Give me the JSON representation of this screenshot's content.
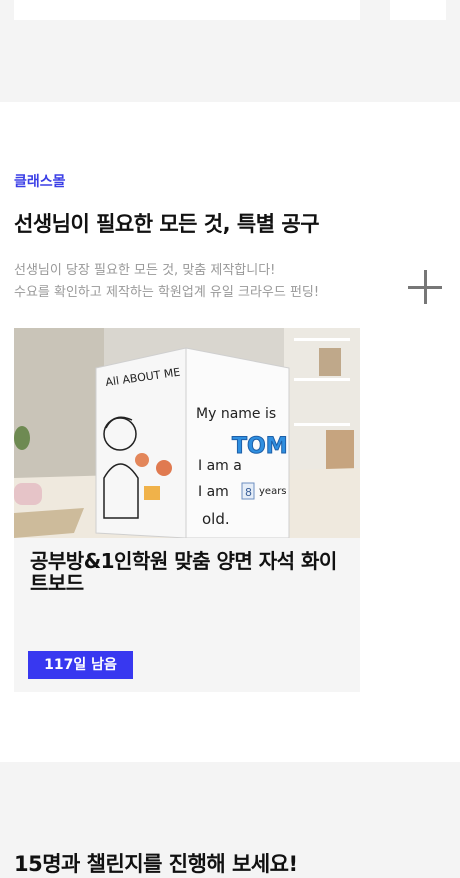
{
  "section": {
    "brand": "클래스몰",
    "title": "선생님이 필요한 모든 것, 특별 공구",
    "description_line1": "선생님이 당장 필요한 모든 것, 맞춤 제작합니다!",
    "description_line2": "수요를 확인하고 제작하는 학원업계 유일 크라우드 펀딩!",
    "expand_icon": "plus-icon"
  },
  "product": {
    "title": "공부방&1인학원 맞춤 양면 자석 화이트보드",
    "days_left": "117일 남음",
    "image_text": {
      "heading": "All ABOUT ME",
      "line1": "My name is",
      "name": "TOM",
      "line2": "I am a",
      "line3": "I am",
      "age": "8",
      "years": "years",
      "line4": "old."
    }
  },
  "next_section": {
    "title": "15명과 챌린지를 진행해 보세요!"
  },
  "colors": {
    "accent": "#3b3fe6",
    "badge": "#3838f0"
  }
}
